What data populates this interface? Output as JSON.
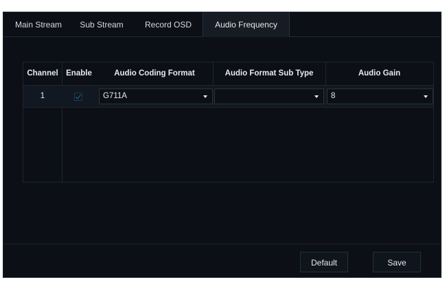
{
  "tabs": [
    {
      "label": "Main Stream",
      "active": false
    },
    {
      "label": "Sub Stream",
      "active": false
    },
    {
      "label": "Record OSD",
      "active": false
    },
    {
      "label": "Audio Frequency",
      "active": true
    }
  ],
  "table": {
    "headers": {
      "channel": "Channel",
      "enable": "Enable",
      "coding_format": "Audio Coding Format",
      "format_sub_type": "Audio Format Sub Type",
      "gain": "Audio Gain"
    },
    "rows": [
      {
        "channel": "1",
        "enabled": true,
        "coding_format": "G711A",
        "format_sub_type": "",
        "gain": "8"
      }
    ]
  },
  "buttons": {
    "default_label": "Default",
    "save_label": "Save"
  },
  "colors": {
    "background": "#0c1016",
    "accent": "#1b6f96",
    "text": "#e6e9ed"
  }
}
